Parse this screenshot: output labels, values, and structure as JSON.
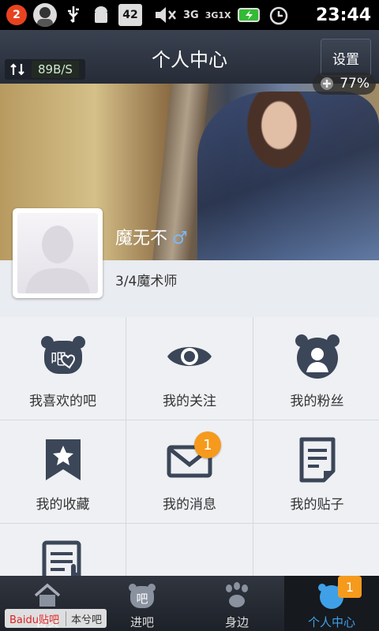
{
  "status_bar": {
    "notification_count": "2",
    "battery_level": "42",
    "network_labels": [
      "3G",
      "3G1X"
    ],
    "time": "23:44"
  },
  "header": {
    "title": "个人中心",
    "settings_label": "设置",
    "net_speed": "89B/S",
    "battery_percent": "77%"
  },
  "profile": {
    "username": "魔无不",
    "gender_symbol": "♂",
    "level": "3/4魔术师"
  },
  "grid": {
    "liked_bars": "我喜欢的吧",
    "following": "我的关注",
    "fans": "我的粉丝",
    "favorites": "我的收藏",
    "messages": "我的消息",
    "messages_badge": "1",
    "posts": "我的贴子"
  },
  "bottom_nav": {
    "home": "首页",
    "enter_bar": "进吧",
    "nearby": "身边",
    "profile_center": "个人中心",
    "profile_badge": "1"
  },
  "watermark": {
    "brand": "Baidu贴吧",
    "tail": "本兮吧"
  },
  "colors": {
    "accent_blue": "#3fa0e8",
    "badge_orange": "#f59a1c",
    "header_bg": "#2e3440"
  }
}
